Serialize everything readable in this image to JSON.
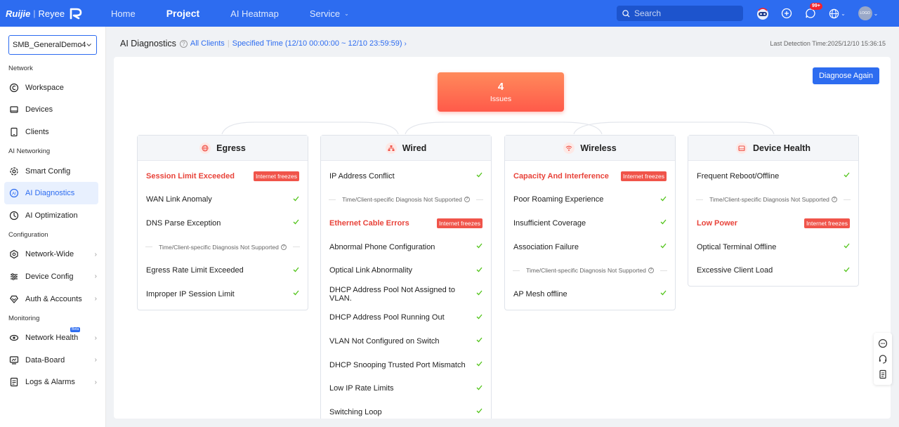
{
  "topbar": {
    "brand": "Ruijie",
    "brand_sep": "|",
    "brand2": "Reyee",
    "nav": [
      {
        "label": "Home",
        "active": false
      },
      {
        "label": "Project",
        "active": true
      },
      {
        "label": "AI Heatmap",
        "active": false
      },
      {
        "label": "Service",
        "active": false,
        "dropdown": true
      }
    ],
    "search_placeholder": "Search",
    "notification_badge": "99+",
    "avatar_text": "LOGO",
    "accent": "#2d6cf0"
  },
  "sidebar": {
    "project": "SMB_GeneralDemo4",
    "sections": [
      {
        "title": "Network",
        "items": [
          {
            "label": "Workspace",
            "icon": "workspace-icon"
          },
          {
            "label": "Devices",
            "icon": "devices-icon"
          },
          {
            "label": "Clients",
            "icon": "clients-icon"
          }
        ]
      },
      {
        "title": "AI Networking",
        "items": [
          {
            "label": "Smart Config",
            "icon": "smart-config-icon"
          },
          {
            "label": "AI Diagnostics",
            "icon": "ai-diagnostics-icon",
            "active": true
          },
          {
            "label": "AI Optimization",
            "icon": "ai-optimization-icon"
          }
        ]
      },
      {
        "title": "Configuration",
        "items": [
          {
            "label": "Network-Wide",
            "icon": "network-wide-icon",
            "arrow": true
          },
          {
            "label": "Device Config",
            "icon": "device-config-icon",
            "arrow": true
          },
          {
            "label": "Auth & Accounts",
            "icon": "auth-icon",
            "arrow": true
          }
        ]
      },
      {
        "title": "Monitoring",
        "items": [
          {
            "label": "Network Health",
            "icon": "network-health-icon",
            "arrow": true,
            "beta": "Beta"
          },
          {
            "label": "Data-Board",
            "icon": "data-board-icon",
            "arrow": true
          },
          {
            "label": "Logs & Alarms",
            "icon": "logs-icon",
            "arrow": true
          }
        ]
      }
    ]
  },
  "header": {
    "title": "AI Diagnostics",
    "clients_link": "All Clients",
    "time_link": "Specified Time (12/10 00:00:00 ~ 12/10 23:59:59)",
    "last_detection": "Last Detection Time:2025/12/10 15:36:15"
  },
  "diagnose_button": "Diagnose Again",
  "issues": {
    "count": "4",
    "label": "Issues"
  },
  "note_text": "Time/Client-specific Diagnosis Not Supported",
  "columns": [
    {
      "title": "Egress",
      "icon": "globe-icon",
      "rows": [
        {
          "label": "Session Limit Exceeded",
          "error": true,
          "tag": "Internet freezes"
        },
        {
          "label": "WAN Link Anomaly"
        },
        {
          "label": "DNS Parse Exception"
        },
        {
          "note": true
        },
        {
          "label": "Egress Rate Limit Exceeded"
        },
        {
          "label": "Improper IP Session Limit"
        }
      ]
    },
    {
      "title": "Wired",
      "icon": "wired-topology-icon",
      "rows": [
        {
          "label": "IP Address Conflict"
        },
        {
          "note": true
        },
        {
          "label": "Ethernet Cable Errors",
          "error": true,
          "tag": "Internet freezes"
        },
        {
          "label": "Abnormal Phone Configuration"
        },
        {
          "label": "Optical Link Abnormality"
        },
        {
          "label": "DHCP Address Pool Not Assigned to VLAN."
        },
        {
          "label": "DHCP Address Pool Running Out"
        },
        {
          "label": "VLAN Not Configured on Switch"
        },
        {
          "label": "DHCP Snooping Trusted Port Mismatch"
        },
        {
          "label": "Low IP Rate Limits"
        },
        {
          "label": "Switching Loop"
        }
      ]
    },
    {
      "title": "Wireless",
      "icon": "wifi-icon",
      "rows": [
        {
          "label": "Capacity And Interference",
          "error": true,
          "tag": "Internet freezes"
        },
        {
          "label": "Poor Roaming Experience"
        },
        {
          "label": "Insufficient Coverage"
        },
        {
          "label": "Association Failure"
        },
        {
          "note": true
        },
        {
          "label": "AP Mesh offline"
        }
      ]
    },
    {
      "title": "Device Health",
      "icon": "device-health-icon",
      "rows": [
        {
          "label": "Frequent Reboot/Offline"
        },
        {
          "note": true
        },
        {
          "label": "Low Power",
          "error": true,
          "tag": "Internet freezes"
        },
        {
          "label": "Optical Terminal Offline"
        },
        {
          "label": "Excessive Client Load"
        }
      ]
    }
  ]
}
